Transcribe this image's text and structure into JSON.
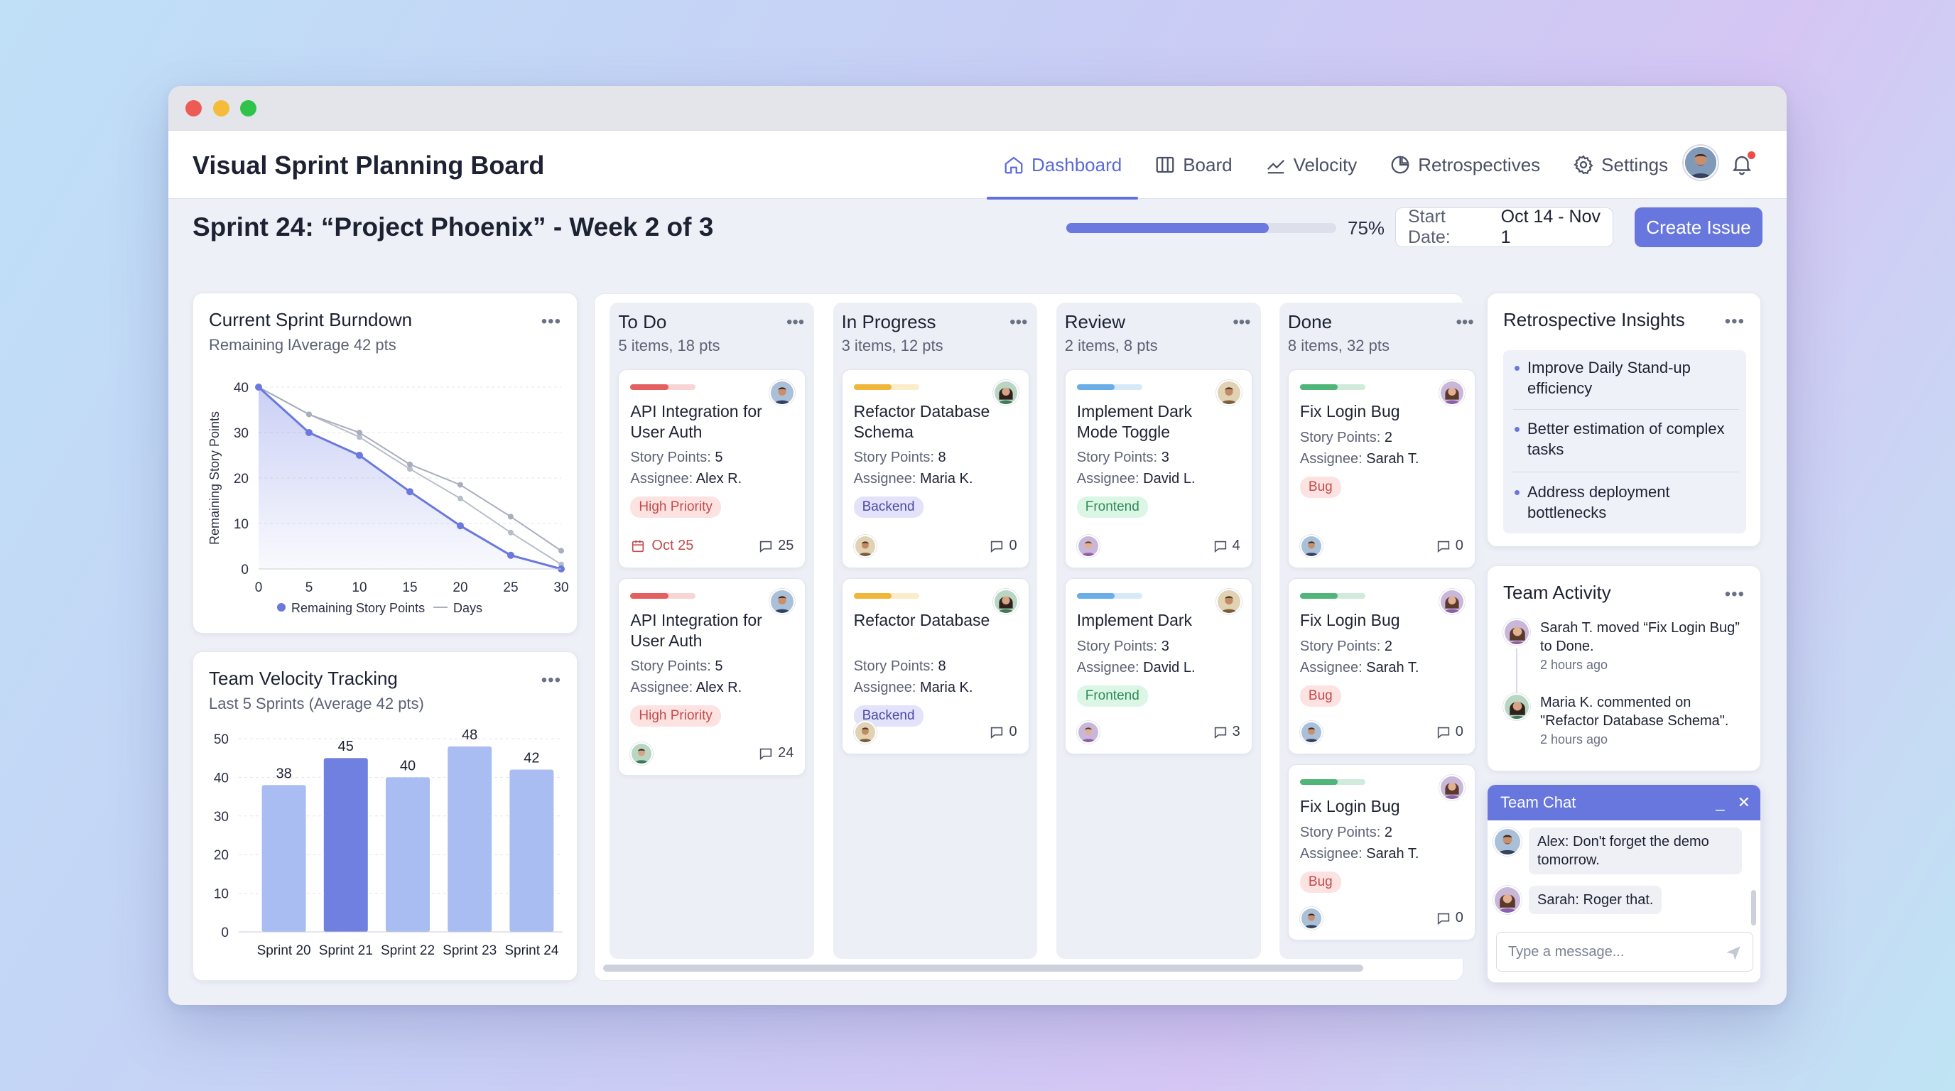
{
  "app": {
    "title": "Visual Sprint Planning Board"
  },
  "nav": [
    {
      "label": "Dashboard",
      "icon": "home-icon",
      "active": true
    },
    {
      "label": "Board",
      "icon": "columns-icon",
      "active": false
    },
    {
      "label": "Velocity",
      "icon": "trend-icon",
      "active": false
    },
    {
      "label": "Retrospectives",
      "icon": "pie-icon",
      "active": false
    },
    {
      "label": "Settings",
      "icon": "gear-icon",
      "active": false
    }
  ],
  "sprint": {
    "title": "Sprint 24: “Project Phoenix” - Week 2 of 3",
    "progress": 0.75,
    "progress_label": "75%",
    "start_label": "Start Date:",
    "date_range": "Oct 14 - Nov 1",
    "create_label": "Create Issue"
  },
  "burndown": {
    "title": "Current Sprint Burndown",
    "subtitle": "Remaining lAverage 42 pts",
    "menu": "•••",
    "chart_data": {
      "type": "line",
      "x": [
        0,
        5,
        10,
        15,
        20,
        25,
        30
      ],
      "xticks": [
        "0",
        "5",
        "10",
        "15",
        "20",
        "25",
        "30"
      ],
      "yticks": [
        "0",
        "10",
        "20",
        "30",
        "40"
      ],
      "ylim": [
        0,
        40
      ],
      "xlim": [
        0,
        30
      ],
      "ylabel": "Remaining Story Points",
      "xlabel": "",
      "series": [
        {
          "name": "Remaining Story Points",
          "values": [
            40,
            30,
            25,
            17,
            9.5,
            3,
            0
          ],
          "color": "#6a78df"
        },
        {
          "name": "Days",
          "values": [
            40,
            34,
            30,
            23,
            18.5,
            11.5,
            4
          ],
          "color": "#a8aebd"
        },
        {
          "name": "",
          "values": [
            40,
            34,
            29,
            22,
            15.5,
            8,
            1
          ],
          "color": "#b8bdca"
        }
      ],
      "legend": "bottom"
    }
  },
  "velocity": {
    "title": "Team Velocity Tracking",
    "subtitle": "Last 5 Sprints (Average 42 pts)",
    "menu": "•••",
    "chart_data": {
      "type": "bar",
      "categories": [
        "Sprint 20",
        "Sprint 21",
        "Sprint 22",
        "Sprint 23",
        "Sprint 24"
      ],
      "values": [
        38,
        45,
        40,
        48,
        42
      ],
      "yticks": [
        "0",
        "10",
        "20",
        "30",
        "40",
        "50"
      ],
      "ylim": [
        0,
        50
      ],
      "highlight_index": 1,
      "colors": {
        "bar": "#a9bdf2",
        "highlight": "#7080e0"
      }
    }
  },
  "board": {
    "columns": [
      {
        "title": "To Do",
        "summary": "5 items, 18 pts",
        "cards": [
          {
            "title": "API Integration for User Auth",
            "points_label": "Story Points:",
            "points": "5",
            "assignee_label": "Assignee:",
            "assignee": "Alex R.",
            "tag": "High Priority",
            "tag_type": "high",
            "bar": "#e46060",
            "due": "Oct 25",
            "comments": "25"
          },
          {
            "title": "API Integration for User Auth",
            "points_label": "Story Points:",
            "points": "5",
            "assignee_label": "Assignee:",
            "assignee": "Alex R.",
            "tag": "High Priority",
            "tag_type": "high",
            "bar": "#e46060",
            "comments": "24"
          }
        ]
      },
      {
        "title": "In Progress",
        "summary": "3 items, 12 pts",
        "cards": [
          {
            "title": "Refactor Database Schema",
            "points_label": "Story Points:",
            "points": "8",
            "assignee_label": "Assignee:",
            "assignee": "Maria K.",
            "tag": "Backend",
            "tag_type": "backend",
            "bar": "#f0b63a",
            "comments": "0"
          },
          {
            "title": "Refactor Database",
            "points_label": "Story Points:",
            "points": "8",
            "assignee_label": "Assignee:",
            "assignee": "Maria K.",
            "tag": "Backend",
            "tag_type": "backend",
            "bar": "#f0b63a",
            "comments": "0"
          }
        ]
      },
      {
        "title": "Review",
        "summary": "2 items, 8 pts",
        "cards": [
          {
            "title": "Implement Dark Mode Toggle",
            "points_label": "Story Points:",
            "points": "3",
            "assignee_label": "Assignee:",
            "assignee": "David L.",
            "tag": "Frontend",
            "tag_type": "frontend",
            "bar": "#6aaee8",
            "comments": "4"
          },
          {
            "title": "Implement Dark",
            "points_label": "Story Points:",
            "points": "3",
            "assignee_label": "Assignee:",
            "assignee": "David L.",
            "tag": "Frontend",
            "tag_type": "frontend",
            "bar": "#6aaee8",
            "comments": "3"
          }
        ]
      },
      {
        "title": "Done",
        "summary": "8 items, 32 pts",
        "cards": [
          {
            "title": "Fix Login Bug",
            "points_label": "Story Points:",
            "points": "2",
            "assignee_label": "Assignee:",
            "assignee": "Sarah T.",
            "tag": "Bug",
            "tag_type": "bug",
            "bar": "#4fb578",
            "comments": "0"
          },
          {
            "title": "Fix Login Bug",
            "points_label": "Story Points:",
            "points": "2",
            "assignee_label": "Assignee:",
            "assignee": "Sarah T.",
            "tag": "Bug",
            "tag_type": "bug",
            "bar": "#4fb578",
            "comments": "0"
          },
          {
            "title": "Fix Login Bug",
            "points_label": "Story Points:",
            "points": "2",
            "assignee_label": "Assignee:",
            "assignee": "Sarah T.",
            "tag": "Bug",
            "tag_type": "bug",
            "bar": "#4fb578",
            "comments": "0"
          }
        ]
      }
    ]
  },
  "insights": {
    "title": "Retrospective Insights",
    "menu": "•••",
    "items": [
      "Improve Daily Stand-up efficiency",
      "Better estimation of complex tasks",
      "Address deployment bottlenecks"
    ]
  },
  "activity": {
    "title": "Team Activity",
    "menu": "•••",
    "items": [
      {
        "text": "Sarah T. moved “Fix Login Bug” to Done.",
        "time": "2 hours ago"
      },
      {
        "text": "Maria K. commented on \"Refactor Database Schema\".",
        "time": "2 hours ago"
      }
    ]
  },
  "chat": {
    "title": "Team Chat",
    "minimize": "_",
    "close": "✕",
    "messages": [
      {
        "text": "Alex: Don't forget the demo tomorrow."
      },
      {
        "text": "Sarah: Roger that."
      }
    ],
    "placeholder": "Type a message..."
  }
}
